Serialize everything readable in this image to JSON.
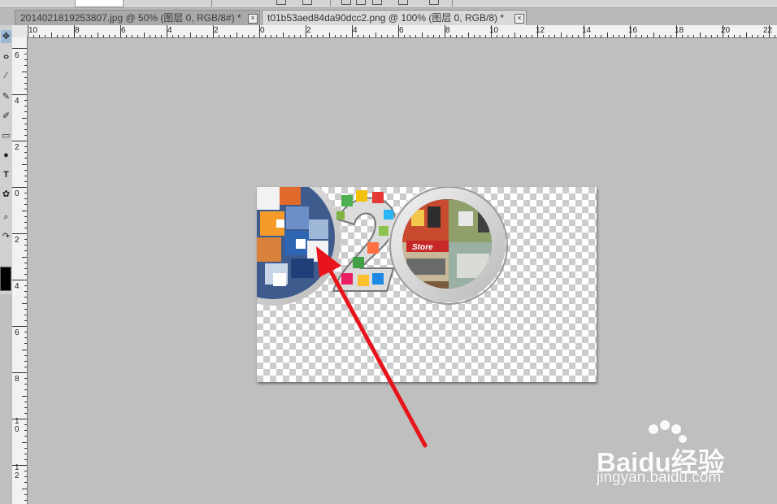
{
  "tabs": [
    {
      "label": "2014021819253807.jpg @ 50% (图层 0, RGB/8#) *",
      "close": "×",
      "active": false
    },
    {
      "label": "t01b53aed84da90dcc2.png @ 100% (图层 0, RGB/8) *",
      "close": "×",
      "active": true
    }
  ],
  "tools": [
    {
      "icon": "move-icon",
      "glyph": "✥"
    },
    {
      "icon": "lasso-icon",
      "glyph": "ⴰ"
    },
    {
      "icon": "eyedropper-icon",
      "glyph": "⁄"
    },
    {
      "icon": "brush-icon",
      "glyph": "✎"
    },
    {
      "icon": "history-brush-icon",
      "glyph": "✐"
    },
    {
      "icon": "eraser-icon",
      "glyph": "▭"
    },
    {
      "icon": "dodge-icon",
      "glyph": "●"
    },
    {
      "icon": "type-icon",
      "glyph": "T"
    },
    {
      "icon": "shape-icon",
      "glyph": "✿"
    },
    {
      "icon": "zoom-icon",
      "glyph": "⌕"
    },
    {
      "icon": "swap-colors-icon",
      "glyph": "↷"
    }
  ],
  "ruler_h": [
    "10",
    "8",
    "6",
    "4",
    "2",
    "0",
    "2",
    "4",
    "6",
    "8",
    "10",
    "12",
    "14",
    "16",
    "18",
    "20",
    "22"
  ],
  "ruler_v": [
    "6",
    "4",
    "2",
    "0",
    "2",
    "4",
    "6",
    "8",
    "10",
    "12"
  ],
  "canvas": {
    "store_sign": "Store"
  },
  "watermark": {
    "brand": "Baidu经验",
    "url": "jingyan.baidu.com"
  },
  "colors": {
    "arrow": "#e8141b",
    "workspace": "#bfbfbf",
    "active_tab": "#d9d9d9"
  }
}
